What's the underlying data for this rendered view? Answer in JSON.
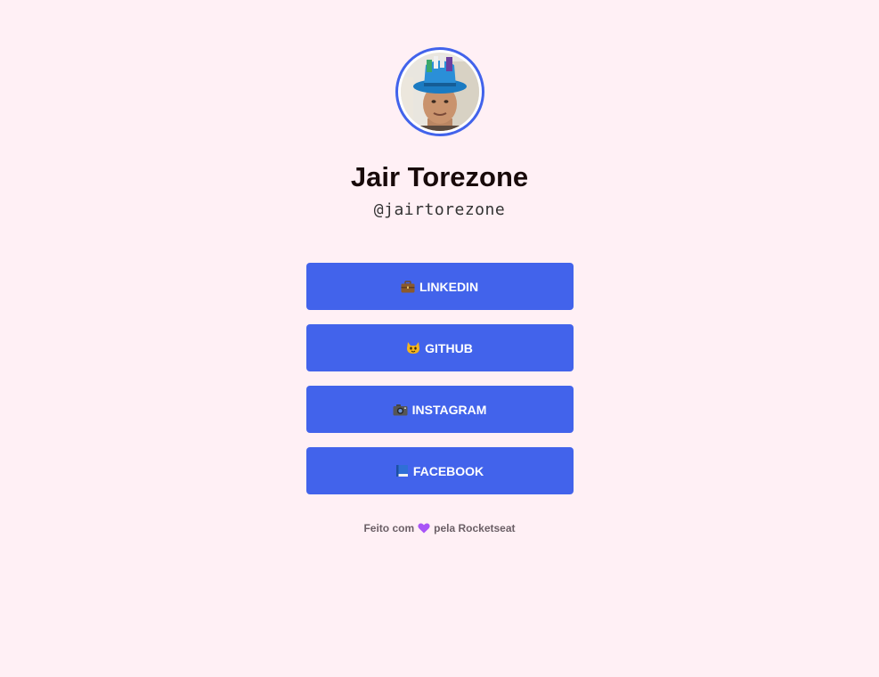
{
  "profile": {
    "name": "Jair Torezone",
    "handle": "@jairtorezone"
  },
  "links": [
    {
      "icon": "briefcase-icon",
      "label": "LINKEDIN"
    },
    {
      "icon": "cat-icon",
      "label": "GITHUB"
    },
    {
      "icon": "camera-icon",
      "label": "INSTAGRAM"
    },
    {
      "icon": "book-icon",
      "label": "FACEBOOK"
    }
  ],
  "footer": {
    "prefix": "Feito com",
    "heart_icon": "purple-heart-icon",
    "suffix": "pela Rocketseat"
  },
  "colors": {
    "background": "#fff0f5",
    "accent": "#4263eb",
    "heart": "#a855f7"
  }
}
